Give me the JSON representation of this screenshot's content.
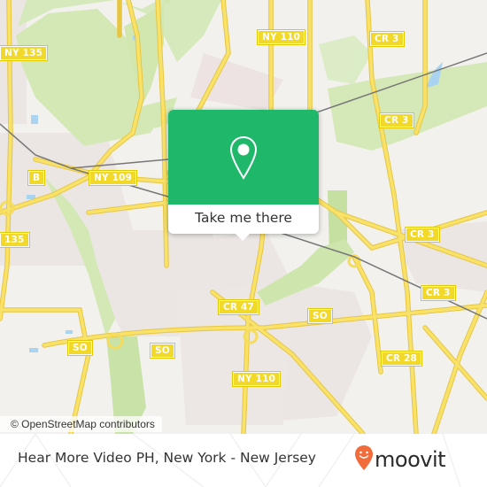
{
  "map": {
    "road_labels": [
      {
        "id": "ny135-top",
        "text": "NY 135"
      },
      {
        "id": "ny110-top",
        "text": "NY 110"
      },
      {
        "id": "cr3-top",
        "text": "CR 3"
      },
      {
        "id": "cr3-mid",
        "text": "CR 3"
      },
      {
        "id": "b",
        "text": "B"
      },
      {
        "id": "ny109",
        "text": "NY 109"
      },
      {
        "id": "ny135-left",
        "text": "135"
      },
      {
        "id": "cr3-right",
        "text": "CR 3"
      },
      {
        "id": "cr3-lower",
        "text": "CR 3"
      },
      {
        "id": "cr47",
        "text": "CR 47"
      },
      {
        "id": "so-mid",
        "text": "SO"
      },
      {
        "id": "so-left",
        "text": "SO"
      },
      {
        "id": "so-center",
        "text": "SO"
      },
      {
        "id": "cr28",
        "text": "CR 28"
      },
      {
        "id": "ny110-bottom",
        "text": "NY 110"
      }
    ],
    "attribution": "© OpenStreetMap contributors",
    "colors": {
      "land": "#f2f1ed",
      "park": "#d4e8b5",
      "residential": "#e8e2e0",
      "road": "#f5dc5a",
      "water": "#a9d3f0",
      "rail": "#777777"
    }
  },
  "popup": {
    "icon": "map-pin-icon",
    "button_label": "Take me there",
    "accent": "#1fb86b"
  },
  "footer": {
    "place_title": "Hear More Video PH, New York - New Jersey",
    "brand": {
      "name": "moovit",
      "icon": "moovit-smiley-pin-icon",
      "icon_color": "#f26b3a"
    }
  }
}
